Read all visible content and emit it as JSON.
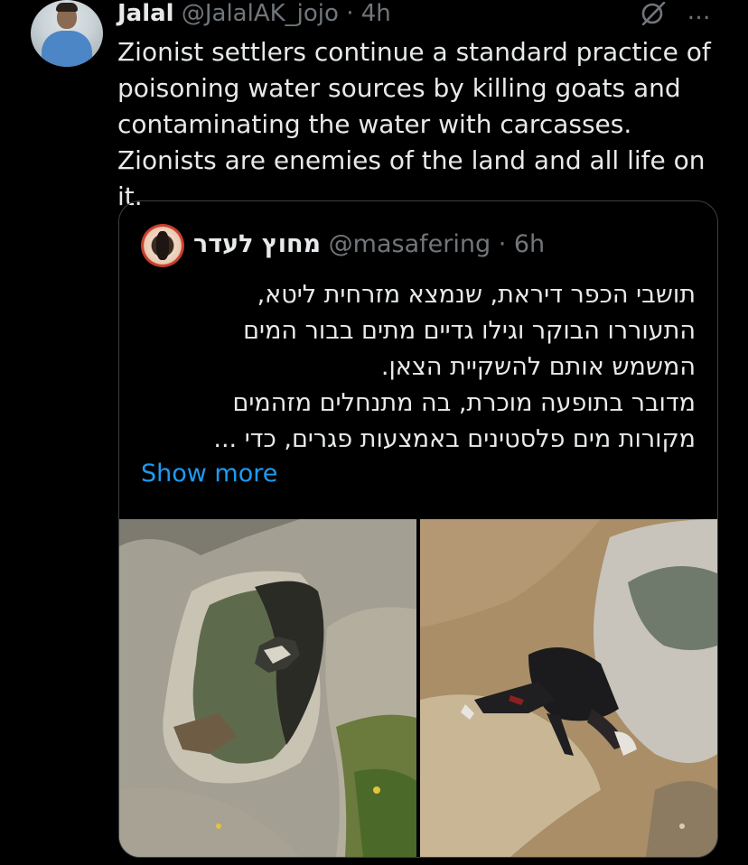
{
  "tweet": {
    "author_name": "Jalal",
    "author_handle": "@JalalAK_jojo",
    "separator": "·",
    "time": "4h",
    "more_icon": "…",
    "icons": [
      "grok-icon",
      "more-icon"
    ],
    "text_lines": [
      "Zionist settlers continue a standard practice of",
      "poisoning water sources by killing goats and",
      "contaminating the water with carcasses.",
      "Zionists are enemies of the land and all life on it."
    ]
  },
  "quote": {
    "author_name": "מחוץ לעדר",
    "author_handle": "@masafering",
    "separator": "·",
    "time": "6h",
    "text_lines": [
      "תושבי הכפר דיראת, שנמצא מזרחית ליטא,",
      "התעוררו הבוקר וגילו גדיים מתים בבור המים",
      "המשמש אותם להשקיית הצאן.",
      "מדובר בתופעה מוכרת, בה מתנחלים מזהמים",
      "מקורות מים פלסטינים באמצעות פגרים, כדי ..."
    ],
    "show_more": "Show more"
  },
  "colors": {
    "background": "#000000",
    "text": "#e7e9ea",
    "muted": "#71767b",
    "link": "#1d9bf0",
    "border": "#3b3f43"
  }
}
